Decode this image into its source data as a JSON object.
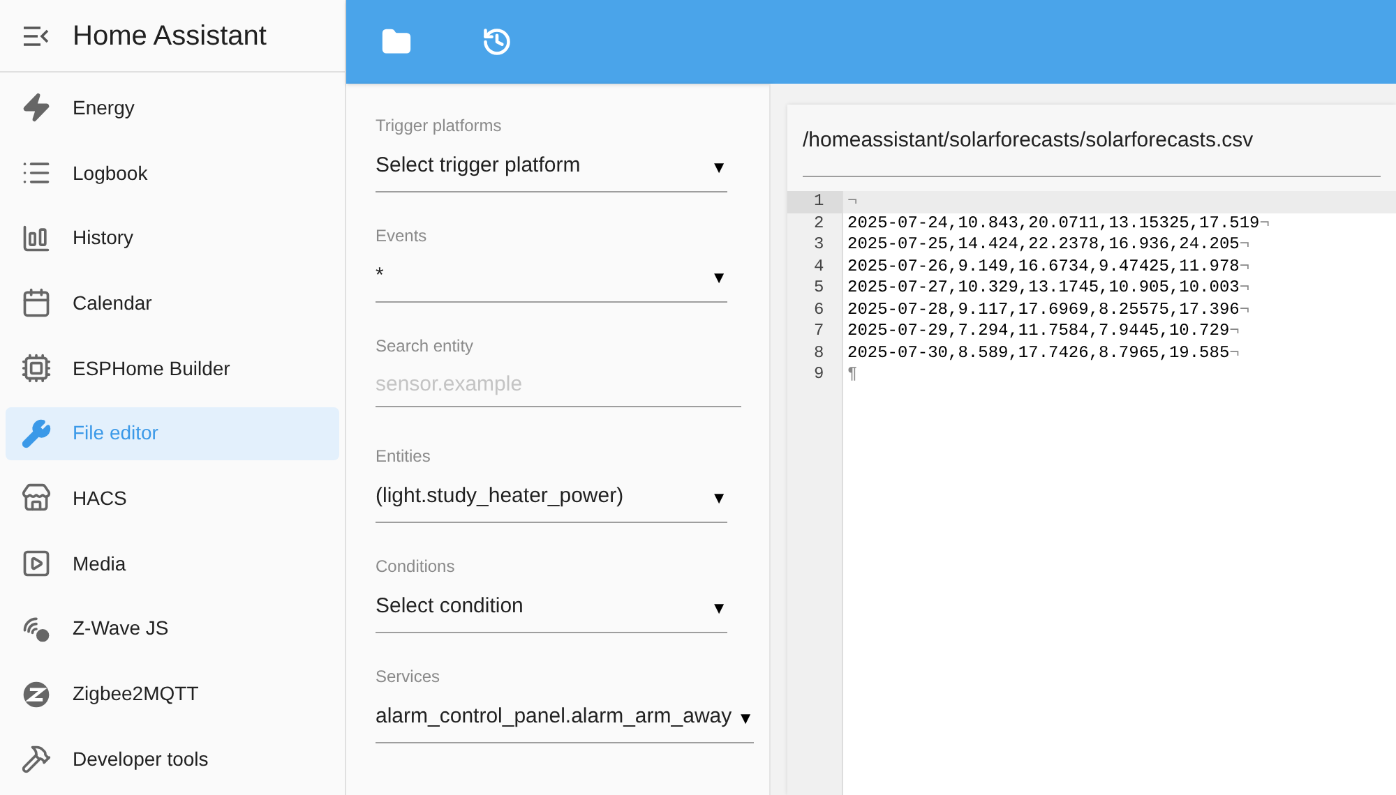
{
  "app_title": "Home Assistant",
  "sidebar": {
    "items": [
      {
        "label": "Energy",
        "selected": false
      },
      {
        "label": "Logbook",
        "selected": false
      },
      {
        "label": "History",
        "selected": false
      },
      {
        "label": "Calendar",
        "selected": false
      },
      {
        "label": "ESPHome Builder",
        "selected": false
      },
      {
        "label": "File editor",
        "selected": true
      },
      {
        "label": "HACS",
        "selected": false
      },
      {
        "label": "Media",
        "selected": false
      },
      {
        "label": "Z-Wave JS",
        "selected": false
      },
      {
        "label": "Zigbee2MQTT",
        "selected": false
      },
      {
        "label": "Developer tools",
        "selected": false
      }
    ]
  },
  "fields": [
    {
      "label": "Trigger platforms",
      "kind": "select",
      "value": "Select trigger platform",
      "arrow": "▼"
    },
    {
      "label": "Events",
      "kind": "select",
      "value": "*",
      "arrow": "▼"
    },
    {
      "label": "Search entity",
      "kind": "input",
      "placeholder": "sensor.example"
    },
    {
      "label": "Entities",
      "kind": "select",
      "value": "(light.study_heater_power)",
      "arrow": "▼"
    },
    {
      "label": "Conditions",
      "kind": "select",
      "value": "Select condition",
      "arrow": "▼"
    },
    {
      "label": "Services",
      "kind": "select",
      "value": "alarm_control_panel.alarm_arm_away",
      "arrow": "▼"
    }
  ],
  "editor": {
    "path": "/homeassistant/solarforecasts/solarforecasts.csv",
    "lines": [
      {
        "number": "1",
        "mark": "¬",
        "current": true
      },
      {
        "number": "2",
        "text": "2025-07-24,10.843,20.0711,13.15325,17.519",
        "mark": "¬",
        "current": false
      },
      {
        "number": "3",
        "text": "2025-07-25,14.424,22.2378,16.936,24.205",
        "mark": "¬",
        "current": false
      },
      {
        "number": "4",
        "text": "2025-07-26,9.149,16.6734,9.47425,11.978",
        "mark": "¬",
        "current": false
      },
      {
        "number": "5",
        "text": "2025-07-27,10.329,13.1745,10.905,10.003",
        "mark": "¬",
        "current": false
      },
      {
        "number": "6",
        "text": "2025-07-28,9.117,17.6969,8.25575,17.396",
        "mark": "¬",
        "current": false
      },
      {
        "number": "7",
        "text": "2025-07-29,7.294,11.7584,7.9445,10.729",
        "mark": "¬",
        "current": false
      },
      {
        "number": "8",
        "text": "2025-07-30,8.589,17.7426,8.7965,19.585",
        "mark": "¬",
        "current": false
      },
      {
        "number": "9",
        "mark": "¶",
        "current": false
      }
    ]
  }
}
